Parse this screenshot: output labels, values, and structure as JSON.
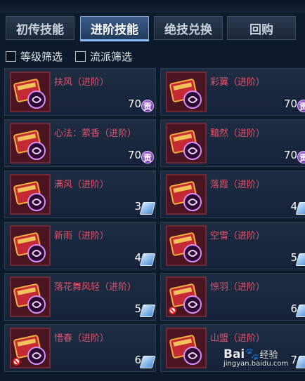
{
  "tabs": [
    {
      "label": "初传技能",
      "active": false
    },
    {
      "label": "进阶技能",
      "active": true
    },
    {
      "label": "绝技兑换",
      "active": false
    },
    {
      "label": "回购",
      "active": false
    }
  ],
  "filters": [
    {
      "label": "等级筛选",
      "checked": false
    },
    {
      "label": "流派筛选",
      "checked": false
    }
  ],
  "items": [
    {
      "name": "扶风（进阶）",
      "price": "70",
      "currency": "gong",
      "currency_label": "贡",
      "locked": false
    },
    {
      "name": "彩翼（进阶）",
      "price": "70",
      "currency": "gong",
      "currency_label": "贡",
      "locked": false
    },
    {
      "name": "心法：萦香（进阶）",
      "price": "70",
      "currency": "gong",
      "currency_label": "贡",
      "locked": false
    },
    {
      "name": "黯然（进阶）",
      "price": "70",
      "currency": "gong",
      "currency_label": "贡",
      "locked": false
    },
    {
      "name": "满风（进阶）",
      "price": "3",
      "currency": "book",
      "currency_label": "",
      "locked": false
    },
    {
      "name": "落霞（进阶）",
      "price": "4",
      "currency": "book",
      "currency_label": "",
      "locked": false
    },
    {
      "name": "新雨（进阶）",
      "price": "4",
      "currency": "book",
      "currency_label": "",
      "locked": false
    },
    {
      "name": "空雪（进阶）",
      "price": "5",
      "currency": "book",
      "currency_label": "",
      "locked": false
    },
    {
      "name": "落花舞风轻（进阶）",
      "price": "5",
      "currency": "book",
      "currency_label": "",
      "locked": false
    },
    {
      "name": "惊羽（进阶）",
      "price": "6",
      "currency": "book",
      "currency_label": "",
      "locked": true
    },
    {
      "name": "惜春（进阶）",
      "price": "6",
      "currency": "book",
      "currency_label": "",
      "locked": true
    },
    {
      "name": "山盟（进阶）",
      "price": "7",
      "currency": "book",
      "currency_label": "",
      "locked": false
    }
  ],
  "watermark": {
    "brand": "Bai",
    "brand2": "经验",
    "url": "jingyan.baidu.com"
  }
}
